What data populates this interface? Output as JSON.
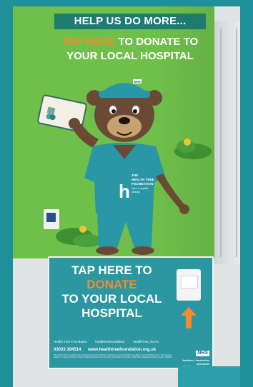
{
  "top_banner": "HELP US DO MORE...",
  "headline": {
    "accent": "TAP HERE",
    "rest_line1": " TO DONATE TO",
    "line2": "YOUR LOCAL HOSPITAL"
  },
  "shirt_logo": {
    "letter": "h",
    "line1": "THE",
    "line2": "HEALTH TREE",
    "line3": "FOUNDATION",
    "line4": "Your hospital",
    "line5": "charity"
  },
  "hat_badge": "NHS",
  "lower_panel": {
    "line1": "TAP HERE TO",
    "accent": "DONATE",
    "line3": "TO YOUR LOCAL",
    "line4": "HOSPITAL"
  },
  "social": {
    "facebook": "Health Tree Foundation",
    "instagram": "healthtreefoundation",
    "twitter": "HealthTree_NLAG"
  },
  "contact": {
    "phone": "03033 304514",
    "website": "www.healthtreefoundation.org.uk"
  },
  "fineprint": "The Health Tree Foundation is the working name of the Northern Lincolnshire and Goole NHS Foundation Trust Charitable Funds. The principal address is: Diana, Princess of Wales Hospital, Scartho Road, Grimsby, North East Lincolnshire, DN33 2BA. Registered charity number: 1053243",
  "nhs": {
    "logo": "NHS",
    "name_line1": "Northern Lincolnshire",
    "name_line2": "and Goole",
    "name_line3": "NHS Foundation Trust"
  },
  "colors": {
    "mural_green": "#6fc04b",
    "teal": "#2a97a1",
    "accent_orange": "#f58a2e",
    "bear_brown": "#6a4a35",
    "scrubs_teal": "#2a97a6"
  }
}
